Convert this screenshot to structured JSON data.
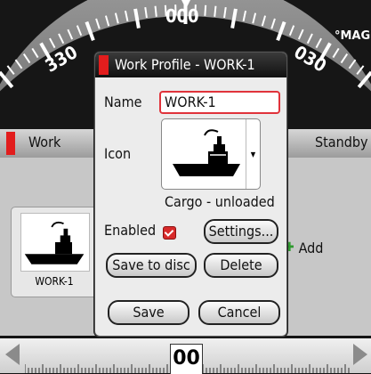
{
  "compass": {
    "headings": [
      "330",
      "000",
      "030"
    ],
    "reference": "°MAG"
  },
  "panel": {
    "active_mode": "Work",
    "standby_label": "Standby",
    "profile_tile_label": "WORK-1",
    "add_label": "Add"
  },
  "rudder": {
    "value": "00"
  },
  "dialog": {
    "title": "Work Profile - WORK-1",
    "name_label": "Name",
    "name_value": "WORK-1",
    "icon_label": "Icon",
    "icon_caption": "Cargo - unloaded",
    "enabled_label": "Enabled",
    "enabled_checked": true,
    "settings_button": "Settings...",
    "save_to_disc_button": "Save to disc",
    "delete_button": "Delete",
    "save_button": "Save",
    "cancel_button": "Cancel"
  },
  "colors": {
    "accent_red": "#e21d1d",
    "dialog_bg": "#ececec",
    "title_bar": "#111111"
  }
}
